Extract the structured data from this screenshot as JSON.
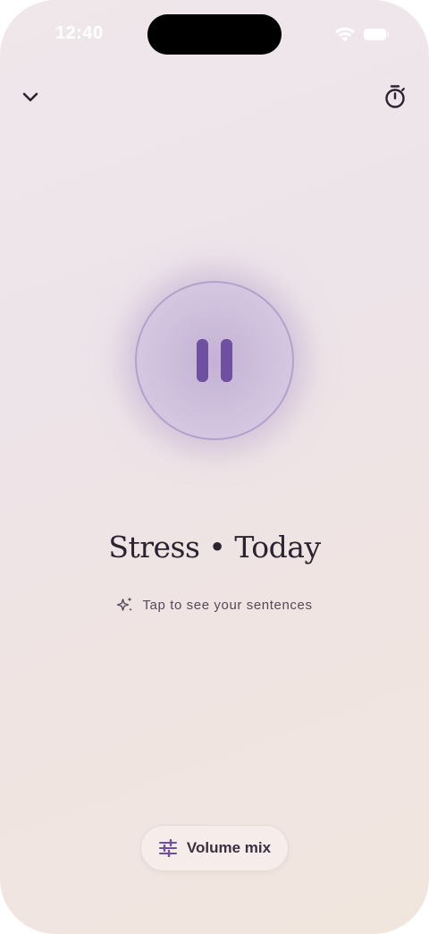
{
  "status_bar": {
    "time": "12:40"
  },
  "header": {
    "collapse_icon": "chevron-down-icon",
    "timer_icon": "timer-icon"
  },
  "player": {
    "state": "playing",
    "control_icon": "pause-icon",
    "accent_color": "#6e4fa0"
  },
  "session": {
    "title": "Stress • Today",
    "hint_icon": "sparkles-icon",
    "hint": "Tap to see your sentences"
  },
  "footer": {
    "volume_icon": "sliders-icon",
    "volume_label": "Volume mix"
  }
}
